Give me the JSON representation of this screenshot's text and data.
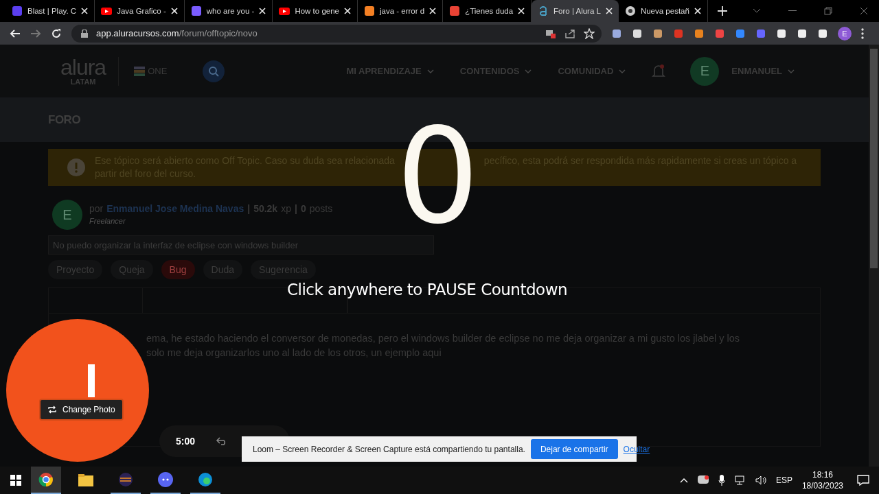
{
  "browser": {
    "tabs": [
      {
        "title": "Blast | Play. C",
        "kind": "square",
        "selected": false
      },
      {
        "title": "Java Grafico -",
        "kind": "video",
        "selected": false
      },
      {
        "title": "who are you -",
        "kind": "square",
        "selected": false
      },
      {
        "title": "How to gene",
        "kind": "video",
        "selected": false
      },
      {
        "title": "java - error d",
        "kind": "square",
        "selected": false
      },
      {
        "title": "¿Tienes duda",
        "kind": "square",
        "selected": false
      },
      {
        "title": "Foro | Alura L",
        "kind": "letter",
        "selected": true
      },
      {
        "title": "Nueva pestañ",
        "kind": "globe",
        "selected": false
      }
    ],
    "url_host": "app.aluracursos.com",
    "url_path": "/forum/offtopic/novo",
    "profile_initial": "E"
  },
  "site": {
    "logo": "alura",
    "logo_sub": "LATAM",
    "partner": "ONE",
    "nav": [
      "MI APRENDIZAJE",
      "CONTENIDOS",
      "COMUNIDAD"
    ],
    "user_initial": "E",
    "user_name": "ENMANUEL"
  },
  "section_title": "FORO",
  "notice": {
    "line1_left": "Ese tópico será abierto como Off Topic. Caso su duda sea relacionada",
    "line1_right": "pecífico, esta podrá ser respondida más rapidamente si creas un tópico a",
    "line2": "partir del foro del curso."
  },
  "author": {
    "initial": "E",
    "by": "por",
    "name": "Enmanuel Jose Medina Navas",
    "separator": "|",
    "xp": "50.2k",
    "xp_unit": "xp",
    "posts": "0",
    "posts_unit": "posts",
    "role": "Freelancer"
  },
  "title_field": {
    "value": "No puedo organizar la interfaz de eclipse con windows builder"
  },
  "tags": [
    {
      "label": "Proyecto",
      "selected": false
    },
    {
      "label": "Queja",
      "selected": false
    },
    {
      "label": "Bug",
      "selected": true
    },
    {
      "label": "Duda",
      "selected": false
    },
    {
      "label": "Sugerencia",
      "selected": false
    }
  ],
  "body_lines": [
    "ema, he estado haciendo el conversor de monedas, pero el windows builder de eclipse no me deja organizar a mi gusto los jlabel y los",
    "solo me deja organizarlos uno al lado de los otros, un ejemplo aqui"
  ],
  "countdown": {
    "number": "0",
    "hint": "Click anywhere to PAUSE Countdown"
  },
  "camera": {
    "button": "Change Photo"
  },
  "recorder": {
    "time": "5:00"
  },
  "share_bar": {
    "message": "Loom – Screen Recorder & Screen Capture está compartiendo tu pantalla.",
    "stop": "Dejar de compartir",
    "hide": "Ocultar"
  },
  "taskbar": {
    "language": "ESP",
    "time": "18:16",
    "date": "18/03/2023"
  }
}
